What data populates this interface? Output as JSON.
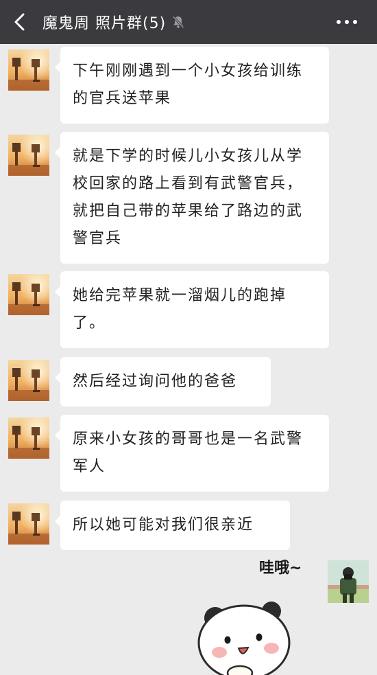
{
  "header": {
    "title": "魔鬼周 照片群(5)",
    "back_icon": "chevron-left-icon",
    "mute_icon": "bell-muted-icon",
    "more_icon": "more-dots-icon"
  },
  "messages": [
    {
      "text": "下午刚刚遇到一个小女孩给训练的官兵送苹果"
    },
    {
      "text": "就是下学的时候儿小女孩儿从学校回家的路上看到有武警官兵，就把自己带的苹果给了路边的武警官兵"
    },
    {
      "text": "她给完苹果就一溜烟儿的跑掉了。"
    },
    {
      "text": "然后经过询问他的爸爸"
    },
    {
      "text": "原来小女孩的哥哥也是一名武警军人"
    },
    {
      "text": "所以她可能对我们很亲近"
    }
  ],
  "sticker": {
    "caption": "哇哦~"
  }
}
